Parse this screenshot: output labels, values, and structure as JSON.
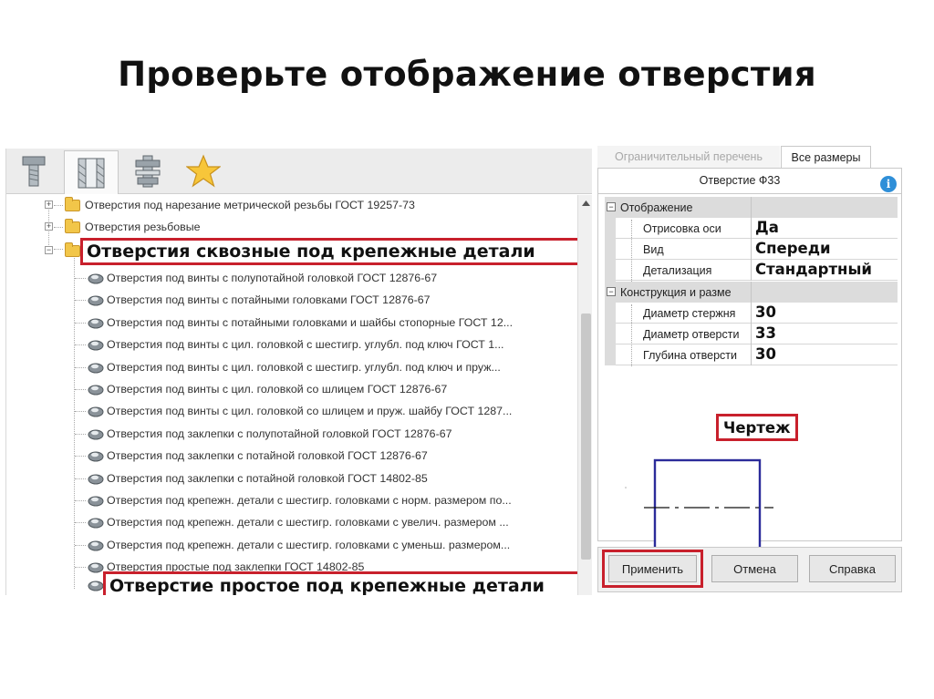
{
  "slide": {
    "title": "Проверьте отображение отверстия"
  },
  "toolbar": {
    "tools": [
      {
        "icon": "bolt-icon",
        "active": false
      },
      {
        "icon": "hole-icon",
        "active": true
      },
      {
        "icon": "fastener-assembly-icon",
        "active": false
      },
      {
        "icon": "star-icon",
        "active": false
      }
    ]
  },
  "tree": {
    "folders": [
      {
        "label": "Отверстия под нарезание метрической резьбы ГОСТ 19257-73",
        "expander": "+"
      },
      {
        "label": "Отверстия резьбовые",
        "expander": "+"
      },
      {
        "label": "Отверстия сквозные под крепежные детали",
        "expander": "−",
        "highlighted": true
      }
    ],
    "items": [
      "Отверстия под винты с полупотайной головкой ГОСТ 12876-67",
      "Отверстия под винты с потайными головками ГОСТ 12876-67",
      "Отверстия под винты с потайными головками и шайбы стопорные ГОСТ 12...",
      "Отверстия под винты с цил. головкой с шестигр. углубл. под ключ ГОСТ 1...",
      "Отверстия под винты с цил. головкой с шестигр. углубл. под ключ и пруж...",
      "Отверстия под винты с цил. головкой со шлицем ГОСТ 12876-67",
      "Отверстия под винты с цил. головкой со шлицем и пруж. шайбу ГОСТ 1287...",
      "Отверстия под заклепки с полупотайной головкой ГОСТ 12876-67",
      "Отверстия под заклепки с потайной головкой ГОСТ 12876-67",
      "Отверстия под заклепки с потайной головкой ГОСТ 14802-85",
      "Отверстия под крепежн. детали с шестигр. головками с норм. размером по...",
      "Отверстия под крепежн. детали с шестигр. головками с увелич. размером ...",
      "Отверстия под крепежн. детали с шестигр. головками с уменьш. размером...",
      "Отверстия простые под заклепки ГОСТ 14802-85"
    ],
    "selected_item": "Отверстие простое под крепежные детали"
  },
  "properties": {
    "tabs": [
      {
        "label": "Ограничительный перечень",
        "active": false
      },
      {
        "label": "Все размеры",
        "active": true
      }
    ],
    "header_title": "Отверстие Ф33",
    "info_symbol": "i",
    "groups": [
      {
        "label": "Отображение",
        "expander": "−",
        "rows": [
          {
            "name": "Отрисовка оси",
            "value": "Да"
          },
          {
            "name": "Вид",
            "value": "Спереди"
          },
          {
            "name": "Детализация",
            "value": "Стандартный"
          }
        ]
      },
      {
        "label": "Конструкция и разме",
        "expander": "−",
        "rows": [
          {
            "name": "Диаметр стержня",
            "value": "30"
          },
          {
            "name": "Диаметр отверсти",
            "value": "33"
          },
          {
            "name": "Глубина отверсти",
            "value": "30"
          }
        ]
      }
    ],
    "drawing_label": "Чертеж"
  },
  "buttons": {
    "apply": "Применить",
    "cancel": "Отмена",
    "help": "Справка"
  },
  "colors": {
    "highlight": "#c8202c",
    "preview_square": "#2b2b9a",
    "info": "#2f8fd8",
    "folder": "#f2c649"
  }
}
